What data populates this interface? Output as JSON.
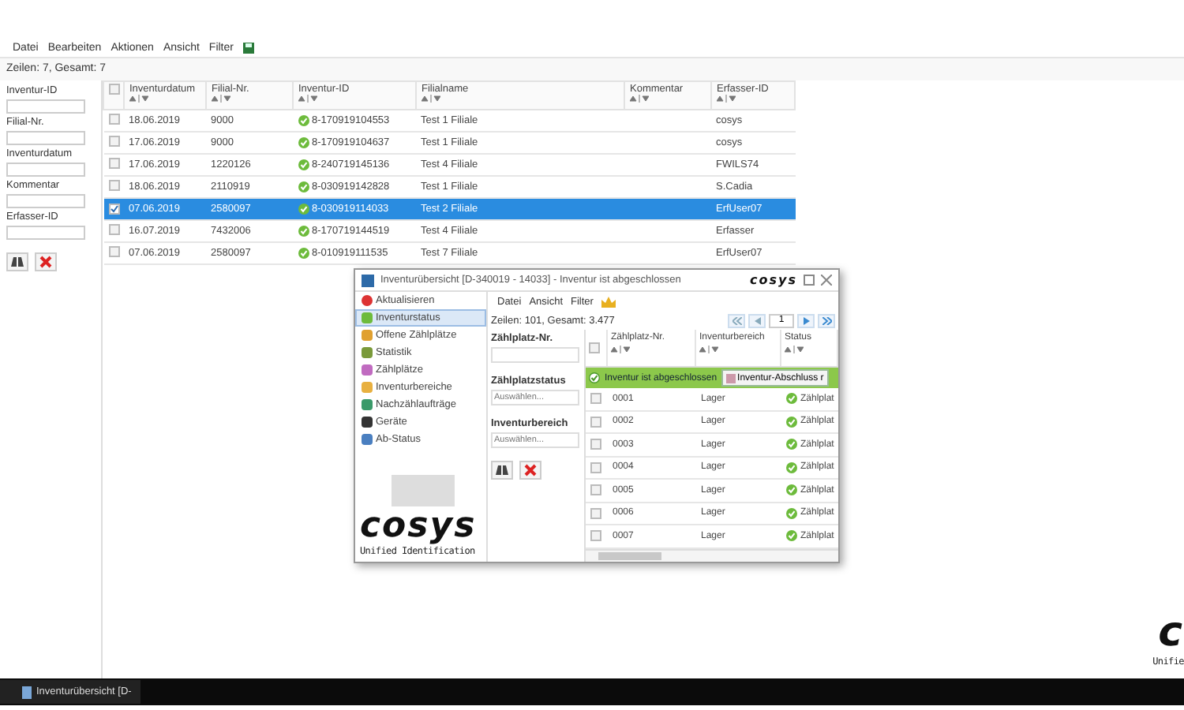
{
  "menu": [
    "Datei",
    "Bearbeiten",
    "Aktionen",
    "Ansicht",
    "Filter"
  ],
  "row_count": "Zeilen: 7, Gesamt: 7",
  "filters": [
    {
      "label": "Inventur-ID"
    },
    {
      "label": "Filial-Nr."
    },
    {
      "label": "Inventurdatum"
    },
    {
      "label": "Kommentar"
    },
    {
      "label": "Erfasser-ID"
    }
  ],
  "table": {
    "columns": [
      "Inventurdatum",
      "Filial-Nr.",
      "Inventur-ID",
      "Filialname",
      "Kommentar",
      "Erfasser-ID"
    ],
    "select_all_checked": false,
    "rows": [
      {
        "selected": false,
        "cells": [
          "18.06.2019",
          "9000",
          "8-170919104553",
          "Test 1 Filiale",
          "",
          "cosys"
        ]
      },
      {
        "selected": false,
        "cells": [
          "17.06.2019",
          "9000",
          "8-170919104637",
          "Test 1 Filiale",
          "",
          "cosys"
        ]
      },
      {
        "selected": false,
        "cells": [
          "17.06.2019",
          "1220126",
          "8-240719145136",
          "Test 4 Filiale",
          "",
          "FWILS74"
        ]
      },
      {
        "selected": false,
        "cells": [
          "18.06.2019",
          "2110919",
          "8-030919142828",
          "Test 1 Filiale",
          "",
          "S.Cadia"
        ]
      },
      {
        "selected": true,
        "cells": [
          "07.06.2019",
          "2580097",
          "8-030919114033",
          "Test 2 Filiale",
          "",
          "ErfUser07"
        ]
      },
      {
        "selected": false,
        "cells": [
          "16.07.2019",
          "7432006",
          "8-170719144519",
          "Test 4 Filiale",
          "",
          "Erfasser"
        ]
      },
      {
        "selected": false,
        "cells": [
          "07.06.2019",
          "2580097",
          "8-010919111535",
          "Test 7 Filiale",
          "",
          "ErfUser07"
        ]
      }
    ]
  },
  "dialog": {
    "title": "Inventurübersicht [D-340019 - 14033] - Inventur ist abgeschlossen",
    "logo": "cosys",
    "refresh": "Aktualisieren",
    "nav": [
      {
        "label": "Inventurstatus",
        "selected": true
      },
      {
        "label": "Offene Zählplätze",
        "selected": false
      },
      {
        "label": "Statistik",
        "selected": false
      },
      {
        "label": "Zählplätze",
        "selected": false
      },
      {
        "label": "Inventurbereiche",
        "selected": false
      },
      {
        "label": "Nachzählaufträge",
        "selected": false
      },
      {
        "label": "Geräte",
        "selected": false
      },
      {
        "label": "Ab-Status",
        "selected": false
      }
    ],
    "brand": {
      "logo": "cosys",
      "tagline": "Unified Identification"
    },
    "menu": [
      "Datei",
      "Ansicht",
      "Filter"
    ],
    "row_count": "Zeilen: 101, Gesamt: 3.477",
    "page": "1",
    "filters": [
      {
        "label": "Zählplatz-Nr."
      },
      {
        "label": "Zählplatzstatus",
        "placeholder": "Auswählen..."
      },
      {
        "label": "Inventurbereich",
        "placeholder": "Auswählen..."
      }
    ],
    "columns": [
      "Zählplatz-Nr.",
      "Inventurbereich",
      "Status"
    ],
    "banner": "Inventur ist abgeschlossen",
    "banner_button": "Inventur-Abschluss r",
    "select_all_checked": false,
    "rows": [
      {
        "checked": false,
        "cells": [
          "0001",
          "Lager",
          "Zählplat"
        ]
      },
      {
        "checked": false,
        "cells": [
          "0002",
          "Lager",
          "Zählplat"
        ]
      },
      {
        "checked": false,
        "cells": [
          "0003",
          "Lager",
          "Zählplat"
        ]
      },
      {
        "checked": false,
        "cells": [
          "0004",
          "Lager",
          "Zählplat"
        ]
      },
      {
        "checked": false,
        "cells": [
          "0005",
          "Lager",
          "Zählplat"
        ]
      },
      {
        "checked": false,
        "cells": [
          "0006",
          "Lager",
          "Zählplat"
        ]
      },
      {
        "checked": false,
        "cells": [
          "0007",
          "Lager",
          "Zählplat"
        ]
      }
    ]
  },
  "corner_logo": {
    "logo": "c",
    "tagline": "Unifie"
  },
  "taskbar": {
    "item": "Inventurübersicht [D-"
  }
}
